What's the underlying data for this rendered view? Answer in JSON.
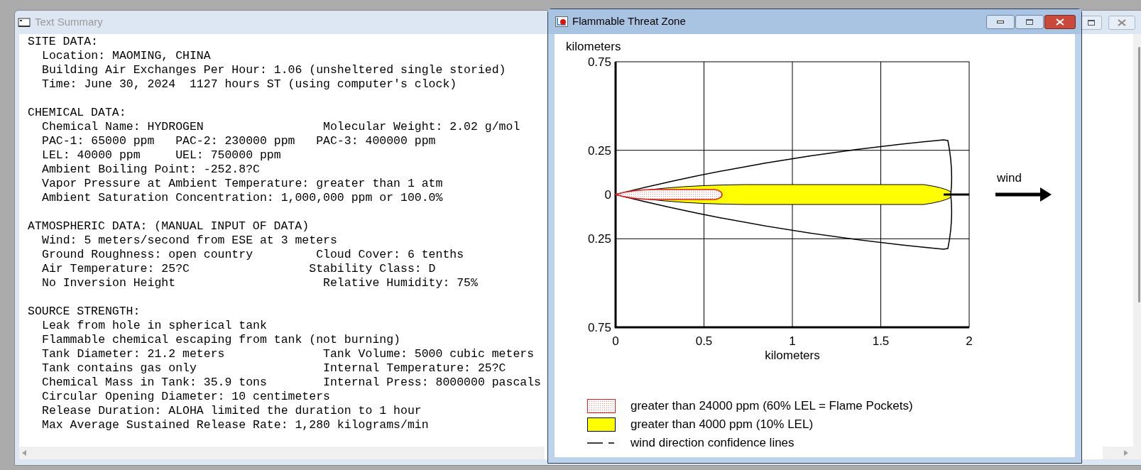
{
  "summary_window": {
    "title": "Text Summary",
    "sections": [
      {
        "heading": "SITE DATA:",
        "lines": [
          "Location: MAOMING, CHINA",
          "Building Air Exchanges Per Hour: 1.06 (unsheltered single storied)",
          "Time: June 30, 2024  1127 hours ST (using computer's clock)"
        ]
      },
      {
        "heading": "CHEMICAL DATA:",
        "lines": [
          "Chemical Name: HYDROGEN                 Molecular Weight: 2.02 g/mol",
          "PAC-1: 65000 ppm   PAC-2: 230000 ppm   PAC-3: 400000 ppm",
          "LEL: 40000 ppm     UEL: 750000 ppm",
          "Ambient Boiling Point: -252.8?C",
          "Vapor Pressure at Ambient Temperature: greater than 1 atm",
          "Ambient Saturation Concentration: 1,000,000 ppm or 100.0%"
        ]
      },
      {
        "heading": "ATMOSPHERIC DATA: (MANUAL INPUT OF DATA)",
        "lines": [
          "Wind: 5 meters/second from ESE at 3 meters",
          "Ground Roughness: open country         Cloud Cover: 6 tenths",
          "Air Temperature: 25?C                 Stability Class: D",
          "No Inversion Height                     Relative Humidity: 75%"
        ]
      },
      {
        "heading": "SOURCE STRENGTH:",
        "lines": [
          "Leak from hole in spherical tank",
          "Flammable chemical escaping from tank (not burning)",
          "Tank Diameter: 21.2 meters              Tank Volume: 5000 cubic meters",
          "Tank contains gas only                  Internal Temperature: 25?C",
          "Chemical Mass in Tank: 35.9 tons        Internal Press: 8000000 pascals",
          "Circular Opening Diameter: 10 centimeters",
          "Release Duration: ALOHA limited the duration to 1 hour",
          "Max Average Sustained Release Rate: 1,280 kilograms/min"
        ]
      }
    ]
  },
  "zone_window": {
    "title": "Flammable Threat Zone",
    "plot": {
      "y_label": "kilometers",
      "x_label": "kilometers",
      "wind_label": "wind",
      "y_ticks": [
        "0.75",
        "0.25",
        "0",
        "0.25",
        "0.75"
      ],
      "x_ticks": [
        "0",
        "0.5",
        "1",
        "1.5",
        "2"
      ]
    },
    "legend": [
      {
        "kind": "flame_pockets",
        "label": "greater than 24000 ppm (60% LEL = Flame Pockets)"
      },
      {
        "kind": "flammable",
        "label": "greater than 4000 ppm (10% LEL)"
      },
      {
        "kind": "confidence_lines",
        "label": "wind direction confidence lines"
      }
    ]
  }
}
